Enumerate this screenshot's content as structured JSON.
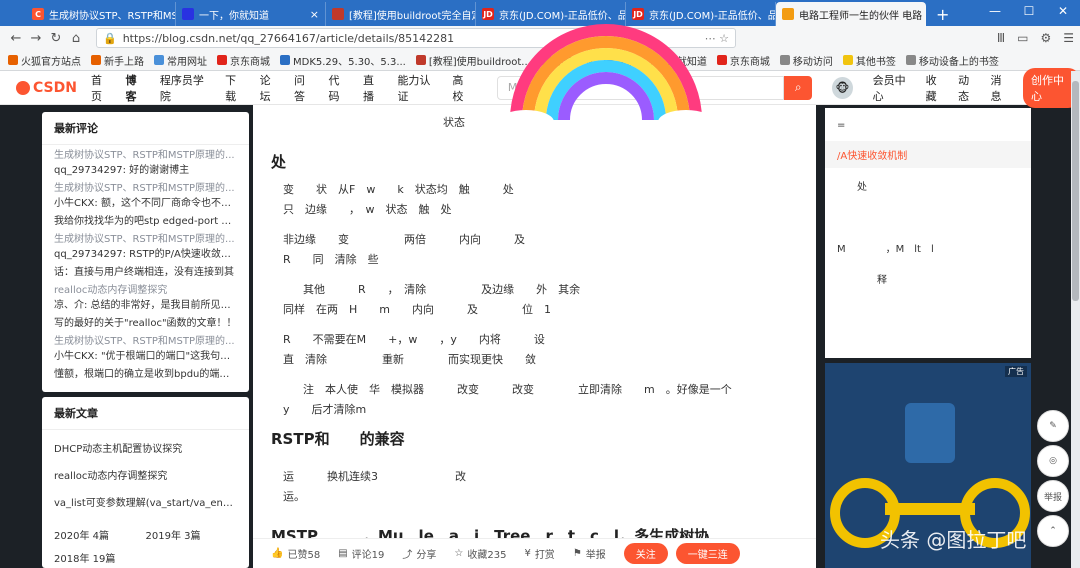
{
  "browser": {
    "tabs": [
      {
        "label": "生成树协议STP、RSTP和MS",
        "color": "#fc5531",
        "fav": "C",
        "active": false
      },
      {
        "label": "一下，你就知道",
        "color": "#2932e1",
        "fav": "",
        "active": false
      },
      {
        "label": "[教程]使用buildroot完全自定",
        "color": "#c0392b",
        "fav": "",
        "active": false
      },
      {
        "label": "京东(JD.COM)-正品低价、品",
        "color": "#e1251b",
        "fav": "JD",
        "active": false
      },
      {
        "label": "京东(JD.COM)-正品低价、品",
        "color": "#e1251b",
        "fav": "JD",
        "active": false
      },
      {
        "label": "电路工程师一生的伙伴 电路",
        "color": "#f39c12",
        "fav": "",
        "active": true
      }
    ],
    "new_tab": "+",
    "url": "https://blog.csdn.net/qq_27664167/article/details/85142281",
    "bookmarks": [
      {
        "label": "火狐官方站点",
        "color": "#e66000"
      },
      {
        "label": "新手上路",
        "color": "#e66000"
      },
      {
        "label": "常用网址",
        "color": "#4a90d9"
      },
      {
        "label": "京东商城",
        "color": "#e1251b"
      },
      {
        "label": "MDK5.29、5.30、5.3...",
        "color": "#2b6fc4"
      },
      {
        "label": "[教程]使用buildroot...",
        "color": "#c0392b"
      },
      {
        "label": "拓普泰克",
        "color": "#888888"
      },
      {
        "label": "百度一下，你就知道",
        "color": "#2932e1"
      },
      {
        "label": "京东商城",
        "color": "#e1251b"
      },
      {
        "label": "移动访问",
        "color": "#888888"
      },
      {
        "label": "其他书签",
        "color": "#f1c40f"
      },
      {
        "label": "移动设备上的书签",
        "color": "#888888"
      }
    ]
  },
  "csdn_nav": {
    "logo": "CSDN",
    "items": [
      "首页",
      "博客",
      "程序员学院",
      "下载",
      "论坛",
      "问答",
      "代码",
      "直播",
      "能力认证",
      "高校"
    ],
    "active_item": "博客",
    "search_placeholder": "MSTP",
    "right_items": [
      "会员中心",
      "收藏",
      "动态",
      "消息"
    ],
    "create_label": "创作中心"
  },
  "left_sidebar": {
    "comments_title": "最新评论",
    "comments": [
      {
        "title": "生成树协议STP、RSTP和MSTP原理的...",
        "body": "qq_29734297: 好的谢谢博主"
      },
      {
        "title": "生成树协议STP、RSTP和MSTP原理的...",
        "body": "小牛CKX: 额，这个不同厂商命令也不同，"
      },
      {
        "title": "",
        "body": "我给你找找华为的吧stp edged-port enat"
      },
      {
        "title": "生成树协议STP、RSTP和MSTP原理的...",
        "body": "qq_29734297: RSTP的P/A快速收敛有名"
      },
      {
        "title": "",
        "body": "话：直接与用户终端相连，没有连接到其"
      },
      {
        "title": "realloc动态内存调整探究",
        "body": "凉、介: 总结的非常好，是我目前所见过的"
      },
      {
        "title": "",
        "body": "写的最好的关于\"realloc\"函数的文章！！"
      },
      {
        "title": "生成树协议STP、RSTP和MSTP原理的...",
        "body": "小牛CKX: \"优于根端口的端口\"这我句没读"
      },
      {
        "title": "",
        "body": "懂额，根端口的确立是收到bpdu的端口次"
      }
    ],
    "articles_title": "最新文章",
    "articles": [
      "DHCP动态主机配置协议探究",
      "realloc动态内存调整探究",
      "va_list可变参数理解(va_start/va_end...)"
    ],
    "archive": [
      "2020年 4篇",
      "2019年 3篇",
      "2018年 19篇"
    ]
  },
  "article": {
    "lines": [
      "状态",
      "处",
      "变　　状　从F　w　　k　状态均　触　　　处",
      "只　边缘　　，　w　状态　触　处",
      "非边缘　　变　　　　　两倍　　　内向　　　及",
      "R　　同　清除　些",
      "其他　　　R　　，　清除　　　　　及边缘　　外　其余",
      "同样　在两　H　　m　　内向　　　及　　　　位　1",
      "R　　不需要在M　　+，w　　，y　　内将　　　设",
      "直　清除　　　　　重新　　　　而实现更快　　敛",
      "注　本人使　华　模拟器　　　改变　　　改变　　　　立即清除　　m　。好像是一个",
      "y　　后才清除m",
      "RSTP和　　的兼容",
      "运　　　换机连续3　　　　　　　改",
      "运。",
      "MSTP　　　，Mu　le　a　i　Tree　r　t　c　l，多生成树协"
    ],
    "heading_indexes": [
      1,
      12,
      15
    ]
  },
  "bottom_bar": {
    "like": "已赞58",
    "comment": "评论19",
    "share": "分享",
    "collect": "收藏235",
    "reward": "打赏",
    "report": "举报",
    "follow": "关注",
    "triple": "一键三连"
  },
  "toc": {
    "items": [
      {
        "label": "=",
        "active": false
      },
      {
        "label": "/A快速收敛机制",
        "active": true
      },
      {
        "label": "　　处",
        "active": false
      },
      {
        "label": "　　　　　　　　　",
        "active": false
      },
      {
        "label": "M　　　　，M　lt　l",
        "active": false
      },
      {
        "label": "　　　　释",
        "active": false
      }
    ]
  },
  "ad": {
    "tag": "广告"
  },
  "float_buttons": [
    "✎",
    "◎",
    "举报",
    "⌃"
  ],
  "watermark": "头条 @图拉丁吧",
  "colors": {
    "accent": "#fc5531",
    "tabbar": "#2b6fc4"
  }
}
